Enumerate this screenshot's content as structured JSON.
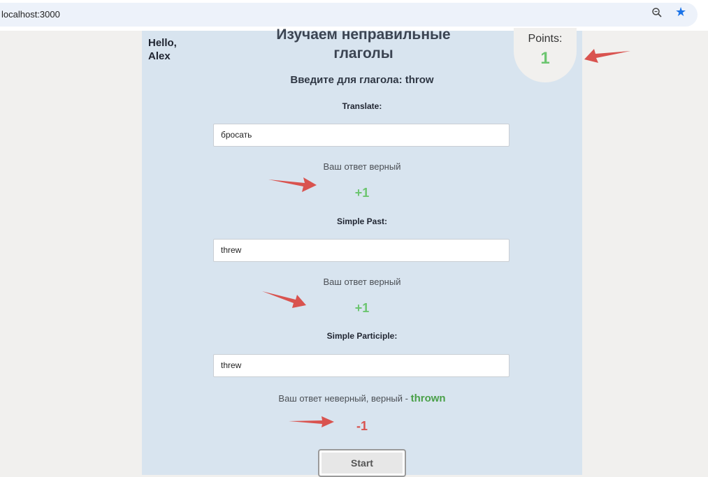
{
  "browser": {
    "url": "localhost:3000",
    "zoom_icon": "zoom-icon",
    "bookmark_icon": "star-icon"
  },
  "header": {
    "greeting": "Hello,",
    "user": "Alex",
    "title_line1": "Изучаем неправильные",
    "title_line2": "глаголы",
    "subtitle": "Введите для глагола: throw"
  },
  "points": {
    "label": "Points:",
    "value": "1"
  },
  "fields": [
    {
      "label": "Translate:",
      "value": "бросать",
      "feedback": "Ваш ответ верный",
      "score": "+1"
    },
    {
      "label": "Simple Past:",
      "value": "threw",
      "feedback": "Ваш ответ верный",
      "score": "+1"
    },
    {
      "label": "Simple Participle:",
      "value": "threw",
      "feedback_prefix": "Ваш ответ неверный, верный - ",
      "correct_answer": "thrown",
      "score": "-1"
    }
  ],
  "start_button": {
    "label": "Start"
  },
  "colors": {
    "panel": "#d8e4ef",
    "plus": "#6cc570",
    "minus": "#d9534f",
    "arrow": "#d9534f"
  }
}
